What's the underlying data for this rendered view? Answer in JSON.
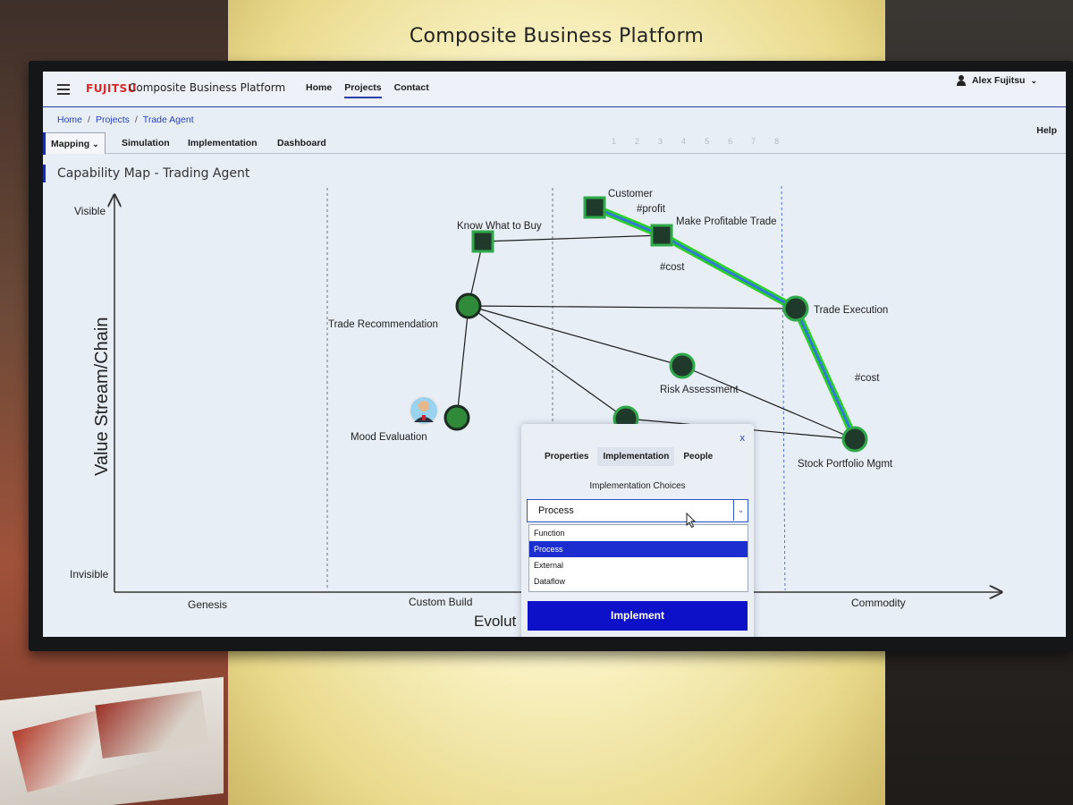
{
  "booth": {
    "title": "Composite Business Platform"
  },
  "header": {
    "logo": "FUJITSU",
    "app_title": "Composite Business Platform",
    "nav": [
      "Home",
      "Projects",
      "Contact"
    ],
    "active_nav": "Projects",
    "user": "Alex Fujitsu"
  },
  "breadcrumb": [
    "Home",
    "Projects",
    "Trade Agent"
  ],
  "tabs": {
    "mapping": "Mapping",
    "items": [
      "Simulation",
      "Implementation",
      "Dashboard"
    ],
    "steps": [
      "1",
      "2",
      "3",
      "4",
      "5",
      "6",
      "7",
      "8"
    ],
    "help": "Help"
  },
  "page_title": "Capability Map - Trading Agent",
  "map": {
    "y_axis_title": "Value Stream/Chain",
    "y_top": "Visible",
    "y_bottom": "Invisible",
    "x_axis_title": "Evolut",
    "x_stages": [
      "Genesis",
      "Custom Build",
      "Commodity"
    ],
    "nodes": {
      "customer": "Customer",
      "know_what_to_buy": "Know What to Buy",
      "make_profitable_trade": "Make Profitable Trade",
      "trade_recommendation": "Trade Recommendation",
      "trade_execution": "Trade Execution",
      "risk_assessment": "Risk Assessment",
      "mood_evaluation": "Mood Evaluation",
      "stock_portfolio_mgmt": "Stock Portfolio Mgmt"
    },
    "tags": {
      "profit": "#profit",
      "cost_top": "#cost",
      "cost_right": "#cost"
    },
    "colors": {
      "node_fill": "#1f3a2a",
      "node_ring": "#2fa84a",
      "flow_green": "#3fd23a",
      "flow_blue": "#2f7ad8"
    }
  },
  "dialog": {
    "close": "x",
    "tabs": [
      "Properties",
      "Implementation",
      "People"
    ],
    "active_tab": "Implementation",
    "label": "Implementation Choices",
    "selected": "Process",
    "options": [
      "Function",
      "Process",
      "External",
      "Dataflow"
    ],
    "implement_label": "Implement"
  }
}
